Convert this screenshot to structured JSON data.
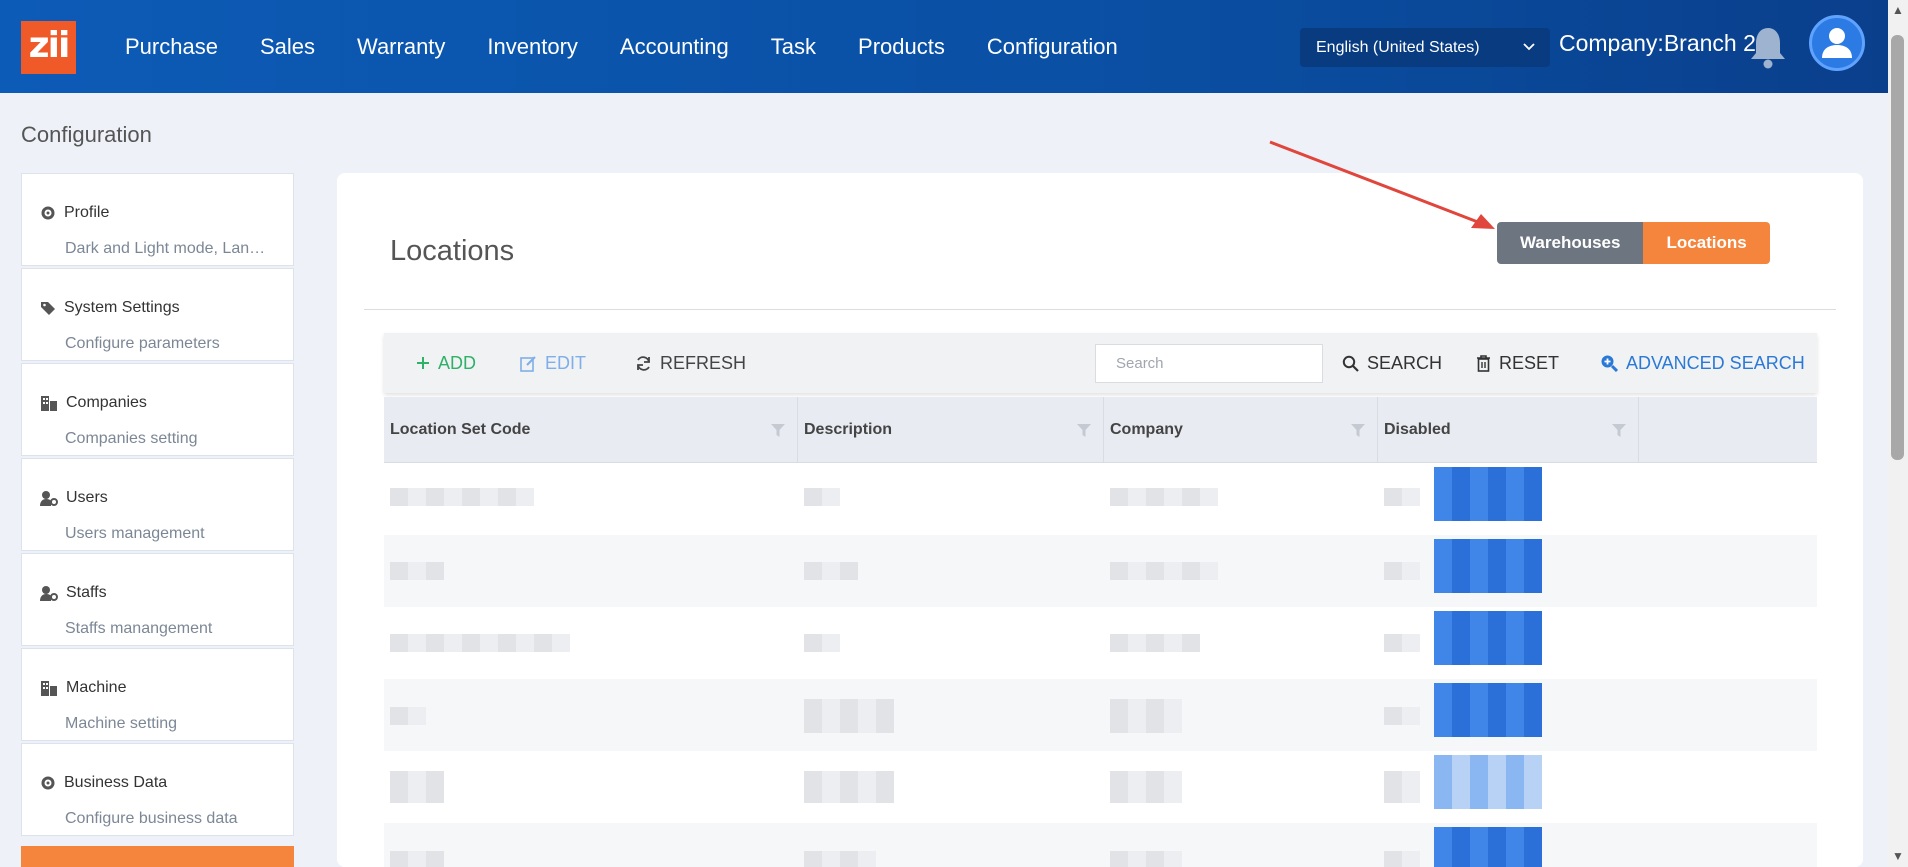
{
  "nav": {
    "logo": "zii",
    "items": [
      "Purchase",
      "Sales",
      "Warranty",
      "Inventory",
      "Accounting",
      "Task",
      "Products",
      "Configuration"
    ],
    "language": "English (United States)",
    "company": "Company:Branch 2"
  },
  "page": {
    "heading": "Configuration"
  },
  "sidebar": {
    "items": [
      {
        "title": "Profile",
        "sub": "Dark and Light mode, Langu...",
        "icon": "gear-icon"
      },
      {
        "title": "System Settings",
        "sub": "Configure parameters",
        "icon": "tags-icon"
      },
      {
        "title": "Companies",
        "sub": "Companies setting",
        "icon": "building-icon"
      },
      {
        "title": "Users",
        "sub": "Users management",
        "icon": "user-cog-icon"
      },
      {
        "title": "Staffs",
        "sub": "Staffs manangement",
        "icon": "user-cog-icon"
      },
      {
        "title": "Machine",
        "sub": "Machine setting",
        "icon": "building-icon"
      },
      {
        "title": "Business Data",
        "sub": "Configure business data",
        "icon": "gear-icon"
      }
    ]
  },
  "panel": {
    "title": "Locations",
    "toggle": {
      "warehouses": "Warehouses",
      "locations": "Locations",
      "active": "Locations"
    }
  },
  "toolbar": {
    "add": "ADD",
    "edit": "EDIT",
    "refresh": "REFRESH",
    "search_placeholder": "Search",
    "search": "SEARCH",
    "reset": "RESET",
    "advanced": "ADVANCED SEARCH"
  },
  "table": {
    "columns": [
      "Location Set Code",
      "Description",
      "Company",
      "Disabled"
    ]
  },
  "colors": {
    "nav": "#0c5bb6",
    "accent": "#f5843c",
    "add": "#2fb16a",
    "link": "#2a79d7"
  }
}
